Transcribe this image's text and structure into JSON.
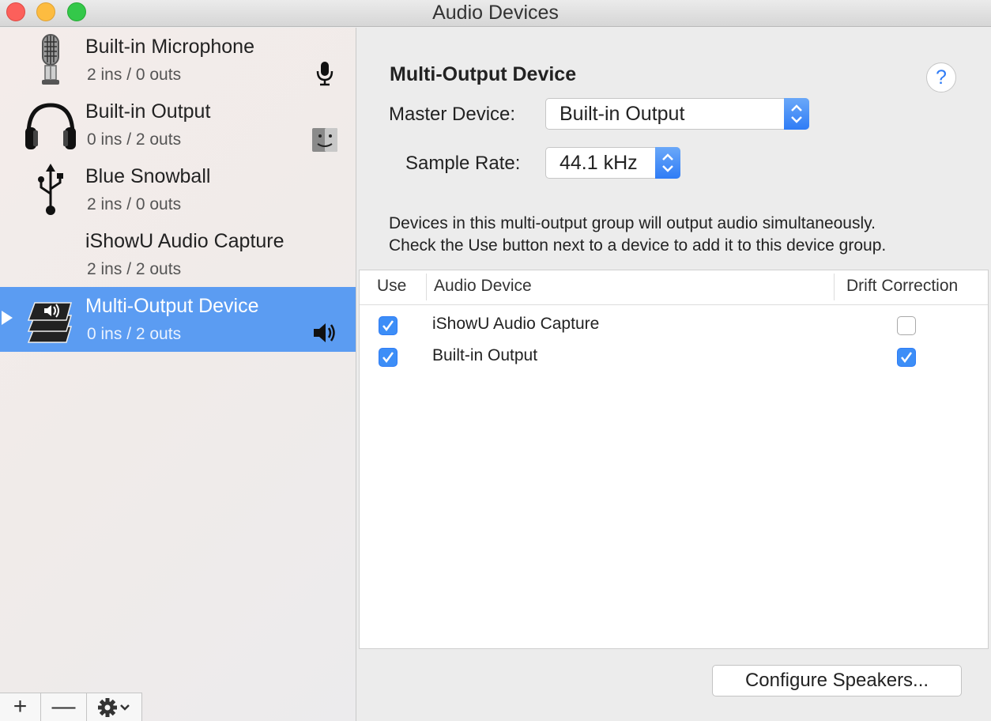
{
  "window": {
    "title": "Audio Devices"
  },
  "sidebar": {
    "devices": [
      {
        "name": "Built-in Microphone",
        "io": "2 ins / 0 outs",
        "icon": "microphone-icon",
        "status_icon": "mic-input-icon"
      },
      {
        "name": "Built-in Output",
        "io": "0 ins / 2 outs",
        "icon": "headphones-icon",
        "status_icon": "finder-icon"
      },
      {
        "name": "Blue Snowball",
        "io": "2 ins / 0 outs",
        "icon": "usb-icon",
        "status_icon": ""
      },
      {
        "name": "iShowU Audio Capture",
        "io": "2 ins / 2 outs",
        "icon": "",
        "status_icon": ""
      },
      {
        "name": "Multi-Output Device",
        "io": "0 ins / 2 outs",
        "icon": "multi-output-icon",
        "status_icon": "speaker-icon",
        "selected": true
      }
    ],
    "toolbar": {
      "add": "+",
      "remove": "—",
      "actions": "gear-icon"
    }
  },
  "detail": {
    "title": "Multi-Output Device",
    "help": "?",
    "master_label": "Master Device:",
    "master_value": "Built-in Output",
    "rate_label": "Sample Rate:",
    "rate_value": "44.1 kHz",
    "desc_line1": "Devices in this multi-output group will output audio simultaneously.",
    "desc_line2": "Check the Use button next to a device to add it to this device group.",
    "table": {
      "col_use": "Use",
      "col_device": "Audio Device",
      "col_drift": "Drift Correction",
      "rows": [
        {
          "use": true,
          "device": "iShowU Audio Capture",
          "drift": false
        },
        {
          "use": true,
          "device": "Built-in Output",
          "drift": true
        }
      ]
    },
    "configure_label": "Configure Speakers..."
  },
  "colors": {
    "accent": "#2f7cf6",
    "selection": "#5b9cf2"
  }
}
